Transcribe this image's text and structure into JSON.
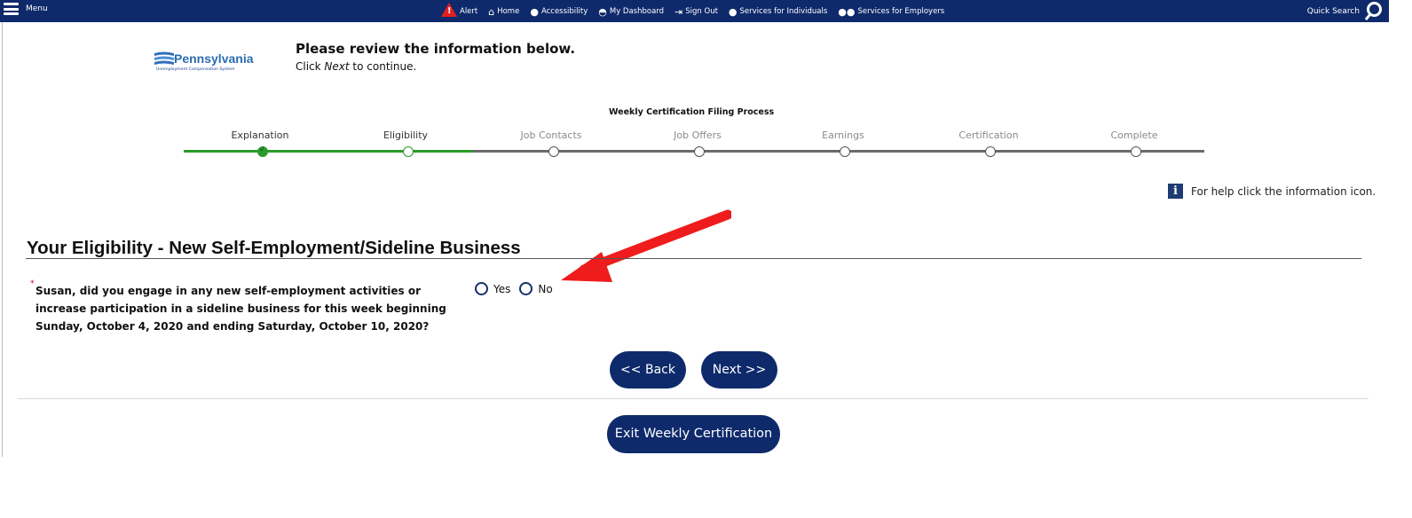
{
  "nav": {
    "menu_label": "Menu",
    "links": [
      "Alert",
      "Home",
      "Accessibility",
      "My Dashboard",
      "Sign Out",
      "Services for Individuals",
      "Services for Employers"
    ],
    "quick_search_label": "Quick Search"
  },
  "logo": {
    "name": "Pennsylvania",
    "subtitle": "Unemployment Compensation System"
  },
  "header": {
    "title": "Please review the information below.",
    "subtitle_prefix": "Click ",
    "subtitle_emphasis": "Next",
    "subtitle_suffix": " to continue."
  },
  "progress": {
    "title": "Weekly Certification Filing Process",
    "steps": [
      "Explanation",
      "Eligibility",
      "Job Contacts",
      "Job Offers",
      "Earnings",
      "Certification",
      "Complete"
    ],
    "completed_steps": 1,
    "current_step": "Eligibility",
    "colors": {
      "done": "#2a9b2a",
      "pending": "#6b6b6b"
    }
  },
  "help": {
    "text": "For help click the information icon."
  },
  "section": {
    "title": "Your Eligibility - New Self-Employment/Sideline Business",
    "required_marker": "*",
    "question": "Susan, did you engage in any new self-employment activities or increase participation in a sideline business for this week beginning Sunday, October 4, 2020 and ending Saturday, October 10, 2020?",
    "options": [
      "Yes",
      "No"
    ],
    "selected": null
  },
  "buttons": {
    "back": "<< Back",
    "next": "Next >>",
    "exit": "Exit Weekly Certification"
  },
  "colors": {
    "navbar": "#0f2a6b",
    "button": "#0e2a6b",
    "arrow": "#ee1c1c"
  }
}
